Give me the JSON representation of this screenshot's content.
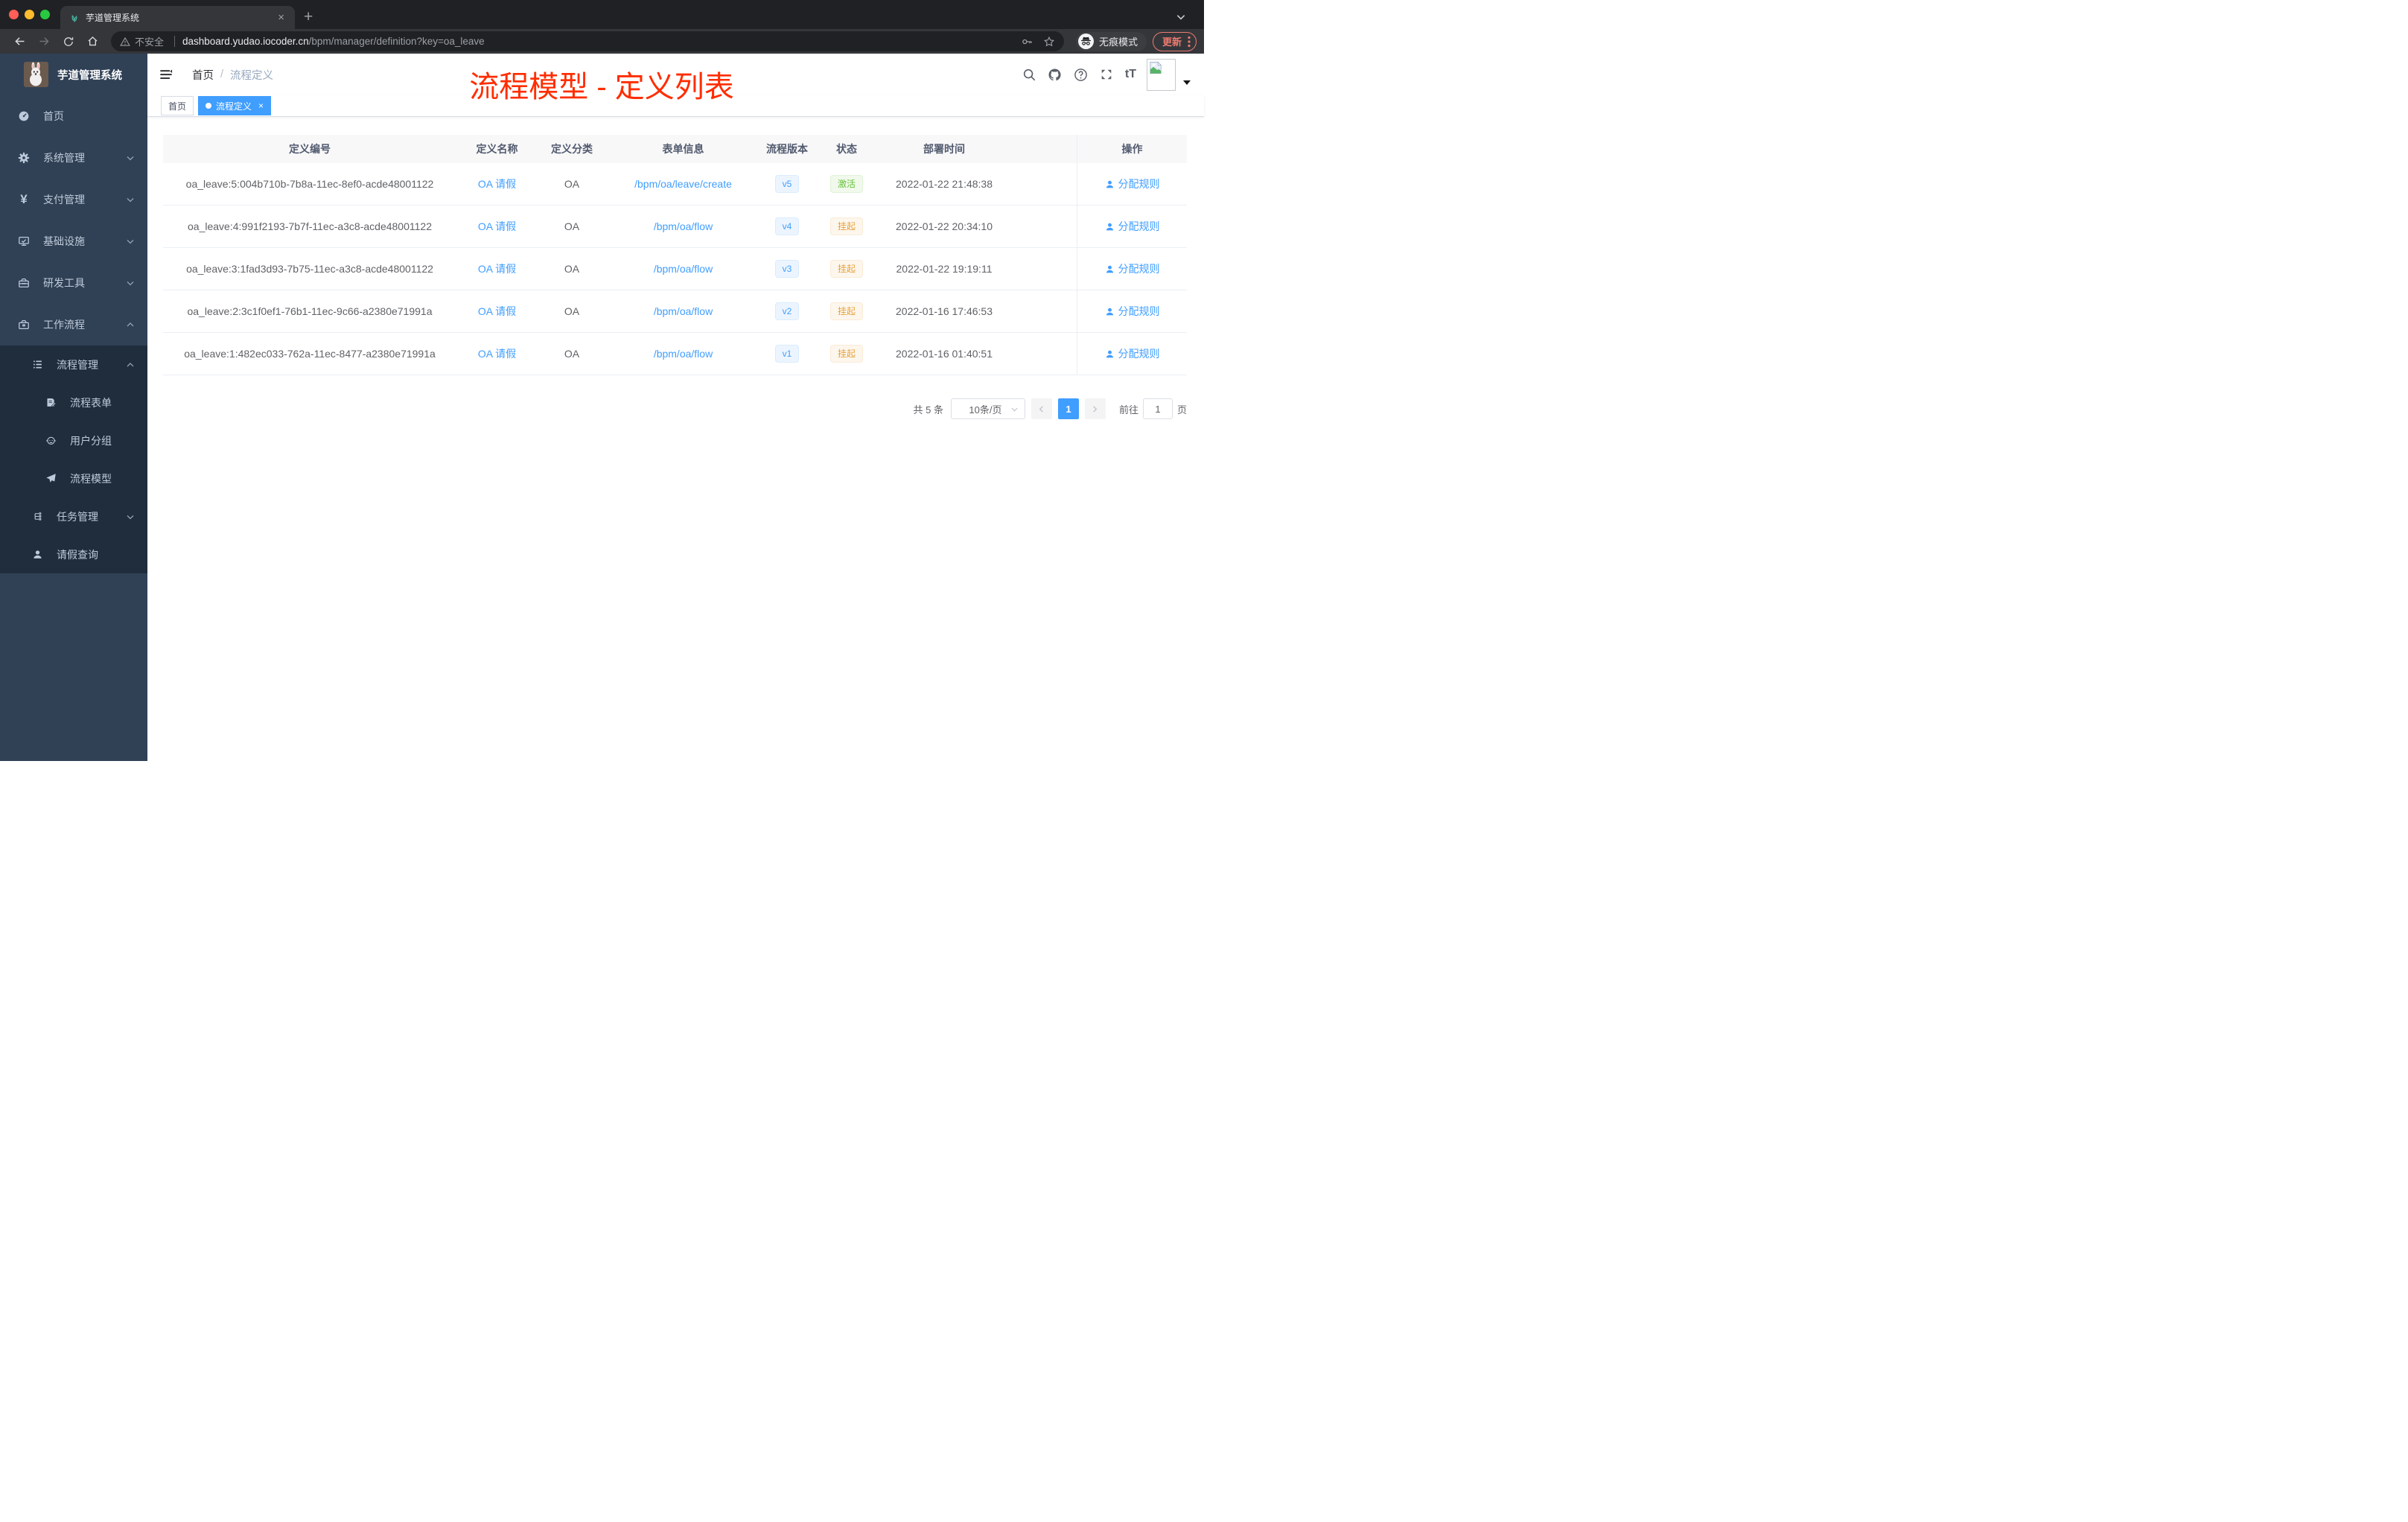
{
  "browser": {
    "tab_title": "芋道管理系统",
    "new_tab": "+",
    "tab_close": "×",
    "security_label": "不安全",
    "url_host": "dashboard.yudao.iocoder.cn",
    "url_path": "/bpm/manager/definition?key=oa_leave",
    "incognito_label": "无痕模式",
    "update_label": "更新"
  },
  "sidebar": {
    "title": "芋道管理系统",
    "items": [
      {
        "label": "首页"
      },
      {
        "label": "系统管理"
      },
      {
        "label": "支付管理"
      },
      {
        "label": "基础设施"
      },
      {
        "label": "研发工具"
      },
      {
        "label": "工作流程"
      }
    ],
    "workflow": {
      "process_mgmt": "流程管理",
      "children": [
        {
          "label": "流程表单"
        },
        {
          "label": "用户分组"
        },
        {
          "label": "流程模型"
        }
      ],
      "task_mgmt": "任务管理",
      "leave_query": "请假查询"
    }
  },
  "header": {
    "breadcrumb_home": "首页",
    "breadcrumb_sep": "/",
    "breadcrumb_current": "流程定义",
    "annotation": "流程模型 - 定义列表"
  },
  "tags": {
    "home": "首页",
    "active": "流程定义",
    "close": "×"
  },
  "table": {
    "columns": {
      "id": "定义编号",
      "name": "定义名称",
      "category": "定义分类",
      "form": "表单信息",
      "version": "流程版本",
      "status": "状态",
      "deploy": "部署时间",
      "actions": "操作"
    },
    "rows": [
      {
        "id": "oa_leave:5:004b710b-7b8a-11ec-8ef0-acde48001122",
        "name": "OA 请假",
        "category": "OA",
        "form": "/bpm/oa/leave/create",
        "version": "v5",
        "status": "激活",
        "deploy": "2022-01-22 21:48:38",
        "action": "分配规则"
      },
      {
        "id": "oa_leave:4:991f2193-7b7f-11ec-a3c8-acde48001122",
        "name": "OA 请假",
        "category": "OA",
        "form": "/bpm/oa/flow",
        "version": "v4",
        "status": "挂起",
        "deploy": "2022-01-22 20:34:10",
        "action": "分配规则"
      },
      {
        "id": "oa_leave:3:1fad3d93-7b75-11ec-a3c8-acde48001122",
        "name": "OA 请假",
        "category": "OA",
        "form": "/bpm/oa/flow",
        "version": "v3",
        "status": "挂起",
        "deploy": "2022-01-22 19:19:11",
        "action": "分配规则"
      },
      {
        "id": "oa_leave:2:3c1f0ef1-76b1-11ec-9c66-a2380e71991a",
        "name": "OA 请假",
        "category": "OA",
        "form": "/bpm/oa/flow",
        "version": "v2",
        "status": "挂起",
        "deploy": "2022-01-16 17:46:53",
        "action": "分配规则"
      },
      {
        "id": "oa_leave:1:482ec033-762a-11ec-8477-a2380e71991a",
        "name": "OA 请假",
        "category": "OA",
        "form": "/bpm/oa/flow",
        "version": "v1",
        "status": "挂起",
        "deploy": "2022-01-16 01:40:51",
        "action": "分配规则"
      }
    ]
  },
  "pagination": {
    "total": "共 5 条",
    "page_size": "10条/页",
    "current_page": "1",
    "goto_label": "前往",
    "goto_value": "1",
    "unit": "页"
  },
  "colors": {
    "primary": "#409EFF",
    "success": "#67C23A",
    "warning": "#E6A23C",
    "annotation": "#FF2D00",
    "sidebar_bg": "#304156",
    "submenu_bg": "#1F2D3D"
  }
}
